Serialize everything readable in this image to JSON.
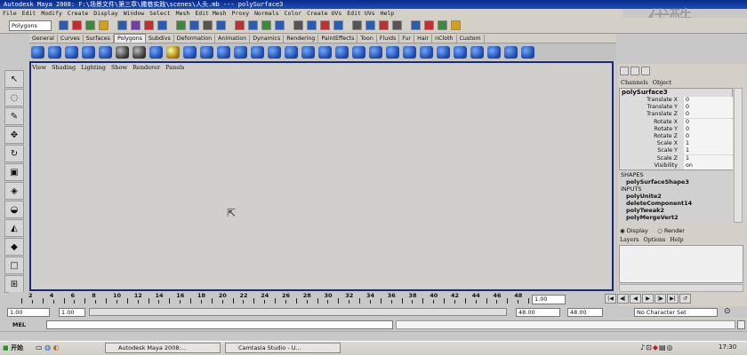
{
  "window": {
    "title": "Autodesk Maya 2008: F:\\场景文件\\第三章\\撒巷实践\\scenes\\人头.mb  ---  polySurface3"
  },
  "menubar": [
    "File",
    "Edit",
    "Modify",
    "Create",
    "Display",
    "Window",
    "Select",
    "Mesh",
    "Edit Mesh",
    "Proxy",
    "Normals",
    "Color",
    "Create UVs",
    "Edit UVs",
    "Help"
  ],
  "status": {
    "mode": "Polygons"
  },
  "shelf_tabs": [
    "General",
    "Curves",
    "Surfaces",
    "Polygons",
    "Subdivs",
    "Deformation",
    "Animation",
    "Dynamics",
    "Rendering",
    "PaintEffects",
    "Toon",
    "Fluids",
    "Fur",
    "Hair",
    "nCloth",
    "Custom"
  ],
  "shelf_active": "Polygons",
  "viewport_menu": [
    "View",
    "Shading",
    "Lighting",
    "Show",
    "Renderer",
    "Panels"
  ],
  "channelbox": {
    "menu": [
      "Channels",
      "Object"
    ],
    "object": "polySurface3",
    "attributes": [
      {
        "label": "Translate X",
        "value": "0"
      },
      {
        "label": "Translate Y",
        "value": "0"
      },
      {
        "label": "Translate Z",
        "value": "0"
      },
      {
        "label": "Rotate X",
        "value": "0"
      },
      {
        "label": "Rotate Y",
        "value": "0"
      },
      {
        "label": "Rotate Z",
        "value": "0"
      },
      {
        "label": "Scale X",
        "value": "1"
      },
      {
        "label": "Scale Y",
        "value": "1"
      },
      {
        "label": "Scale Z",
        "value": "1"
      },
      {
        "label": "Visibility",
        "value": "on"
      }
    ],
    "shapes_header": "SHAPES",
    "shape": "polySurfaceShape3",
    "inputs_header": "INPUTS",
    "inputs": [
      "polyUnite2",
      "deleteComponent14",
      "polyTweak2",
      "polyMergeVert2"
    ]
  },
  "layers": {
    "display": "Display",
    "render": "Render",
    "menu": [
      "Layers",
      "Options",
      "Help"
    ]
  },
  "timeline": {
    "ticks": [
      "2",
      "4",
      "6",
      "8",
      "10",
      "12",
      "14",
      "16",
      "18",
      "20",
      "22",
      "24",
      "26",
      "28",
      "30",
      "32",
      "34",
      "36",
      "38",
      "40",
      "42",
      "44",
      "46",
      "48"
    ],
    "current": "1.00"
  },
  "range": {
    "start": "1.00",
    "start2": "1.00",
    "end": "48.00",
    "end2": "48.00",
    "char_set": "No Character Set"
  },
  "mel": {
    "label": "MEL"
  },
  "taskbar": {
    "start": "开始",
    "buttons": [
      "Autodesk Maya 2008:...",
      "Camtasia Studio - U..."
    ],
    "clock": "17:30"
  },
  "watermark": "优酷"
}
